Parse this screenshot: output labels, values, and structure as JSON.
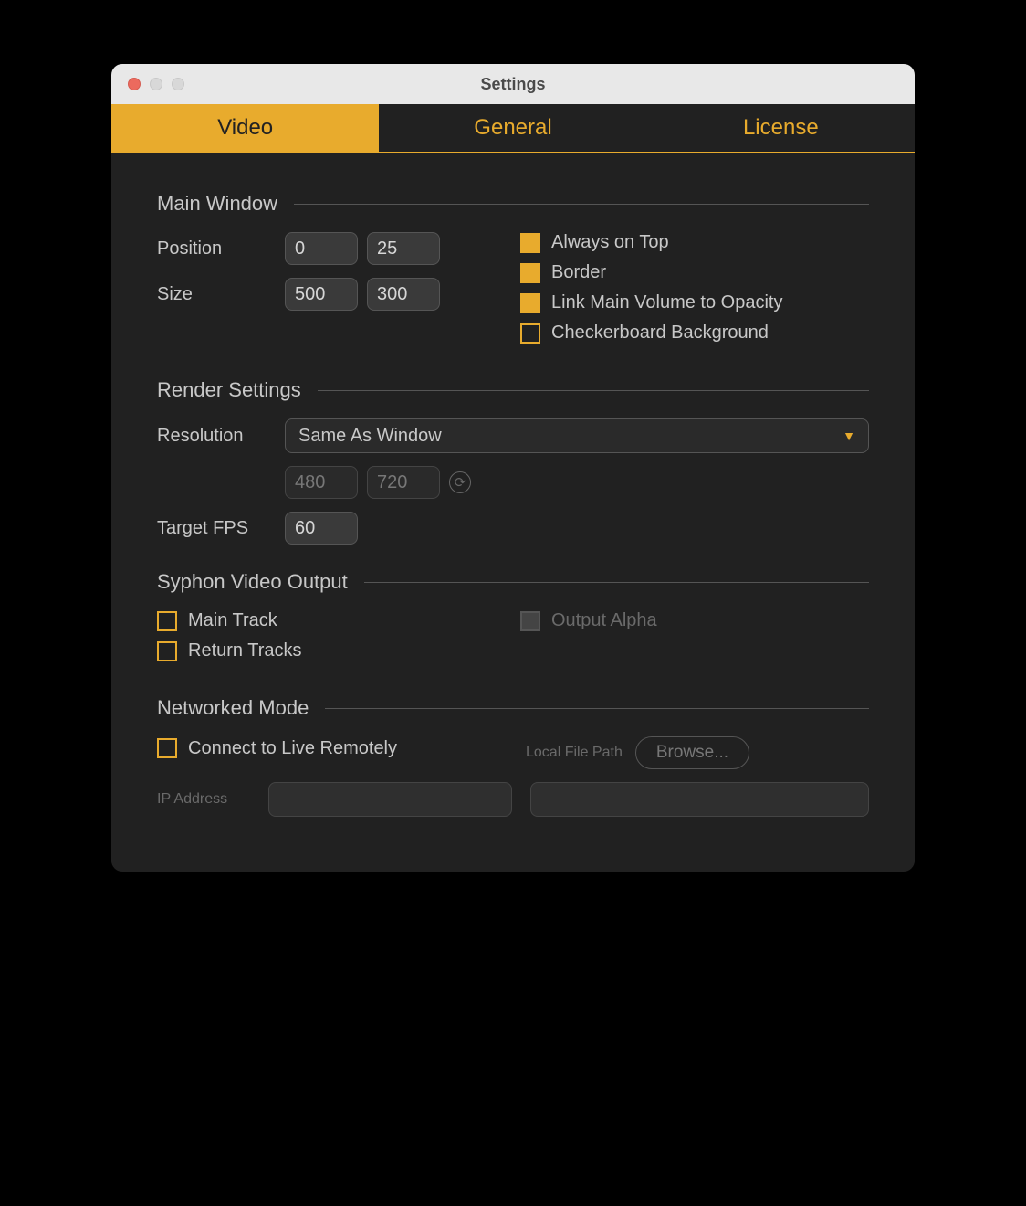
{
  "window": {
    "title": "Settings"
  },
  "tabs": {
    "video": "Video",
    "general": "General",
    "license": "License"
  },
  "sections": {
    "main_window": {
      "title": "Main Window",
      "position_label": "Position",
      "position_x": "0",
      "position_y": "25",
      "size_label": "Size",
      "size_w": "500",
      "size_h": "300",
      "always_on_top": "Always on Top",
      "border": "Border",
      "link_volume": "Link Main Volume to Opacity",
      "checkerboard": "Checkerboard Background"
    },
    "render": {
      "title": "Render Settings",
      "resolution_label": "Resolution",
      "resolution_value": "Same As Window",
      "res_w_placeholder": "480",
      "res_h_placeholder": "720",
      "target_fps_label": "Target FPS",
      "target_fps": "60"
    },
    "syphon": {
      "title": "Syphon Video Output",
      "main_track": "Main Track",
      "return_tracks": "Return Tracks",
      "output_alpha": "Output Alpha"
    },
    "network": {
      "title": "Networked Mode",
      "connect": "Connect to Live Remotely",
      "local_path": "Local File Path",
      "browse": "Browse...",
      "ip_label": "IP Address",
      "ip_value": "",
      "path_value": ""
    }
  }
}
